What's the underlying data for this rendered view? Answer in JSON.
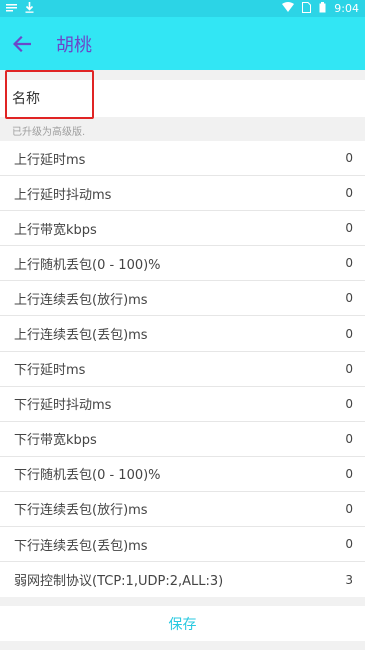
{
  "status_bar": {
    "time": "9:04",
    "icons": [
      "notification-icon",
      "download-icon",
      "wifi-icon",
      "sim-icon",
      "battery-icon"
    ]
  },
  "app_bar": {
    "title": "胡桃",
    "back_icon": "arrow-left-icon"
  },
  "form": {
    "name_placeholder": "名称",
    "upgrade_note": "已升级为高级版.",
    "fields": [
      {
        "label": "上行延时ms",
        "value": "0"
      },
      {
        "label": "上行延时抖动ms",
        "value": "0"
      },
      {
        "label": "上行带宽kbps",
        "value": "0"
      },
      {
        "label": "上行随机丢包(0 - 100)%",
        "value": "0"
      },
      {
        "label": "上行连续丢包(放行)ms",
        "value": "0"
      },
      {
        "label": "上行连续丢包(丢包)ms",
        "value": "0"
      },
      {
        "label": "下行延时ms",
        "value": "0"
      },
      {
        "label": "下行延时抖动ms",
        "value": "0"
      },
      {
        "label": "下行带宽kbps",
        "value": "0"
      },
      {
        "label": "下行随机丢包(0 - 100)%",
        "value": "0"
      },
      {
        "label": "下行连续丢包(放行)ms",
        "value": "0"
      },
      {
        "label": "下行连续丢包(丢包)ms",
        "value": "0"
      },
      {
        "label": "弱网控制协议(TCP:1,UDP:2,ALL:3)",
        "value": "3"
      }
    ],
    "save_label": "保存"
  },
  "colors": {
    "status_bar": "#2cd4e6",
    "app_bar": "#32e6f4",
    "title": "#6b48c9",
    "save": "#29c9e0",
    "highlight": "#e02424"
  }
}
